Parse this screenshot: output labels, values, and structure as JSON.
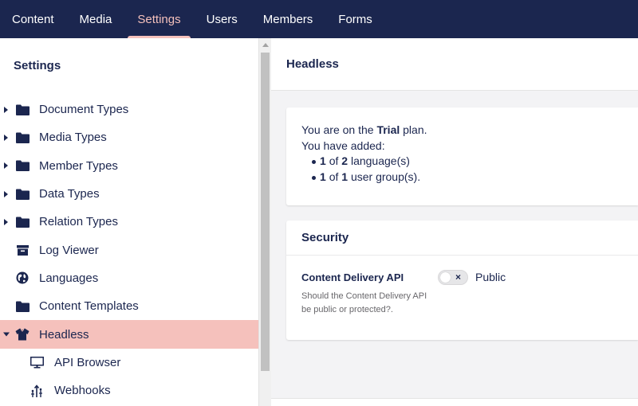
{
  "nav": {
    "items": [
      {
        "label": "Content"
      },
      {
        "label": "Media"
      },
      {
        "label": "Settings"
      },
      {
        "label": "Users"
      },
      {
        "label": "Members"
      },
      {
        "label": "Forms"
      }
    ],
    "active": "Settings"
  },
  "sidebar": {
    "title": "Settings",
    "items": [
      {
        "label": "Document Types",
        "icon": "folder-icon",
        "expandable": true
      },
      {
        "label": "Media Types",
        "icon": "folder-icon",
        "expandable": true
      },
      {
        "label": "Member Types",
        "icon": "folder-icon",
        "expandable": true
      },
      {
        "label": "Data Types",
        "icon": "folder-icon",
        "expandable": true
      },
      {
        "label": "Relation Types",
        "icon": "folder-icon",
        "expandable": true
      },
      {
        "label": "Log Viewer",
        "icon": "archive-icon",
        "expandable": false
      },
      {
        "label": "Languages",
        "icon": "globe-icon",
        "expandable": false
      },
      {
        "label": "Content Templates",
        "icon": "folder-icon",
        "expandable": false
      },
      {
        "label": "Headless",
        "icon": "headless-icon",
        "expandable": true,
        "expanded": true,
        "selected": true
      },
      {
        "label": "API Browser",
        "icon": "monitor-icon",
        "child": true
      },
      {
        "label": "Webhooks",
        "icon": "webhook-icon",
        "child": true
      }
    ]
  },
  "main": {
    "title": "Headless",
    "plan": {
      "line1_prefix": "You are on the",
      "plan_name": "Trial",
      "line1_suffix": "plan.",
      "line2": "You have added:",
      "languages": {
        "used": "1",
        "of": "of",
        "total": "2",
        "unit": "language(s)"
      },
      "user_groups": {
        "used": "1",
        "of": "of",
        "total": "1",
        "unit": "user group(s)."
      }
    },
    "security": {
      "title": "Security",
      "property_label": "Content Delivery API",
      "property_description": "Should the Content Delivery API be public or protected?.",
      "toggle_label": "Public",
      "toggle_on": false,
      "toggle_symbol": "×"
    }
  },
  "colors": {
    "navy": "#1b264f",
    "accent": "#f5c1bc",
    "muted": "#68676b"
  }
}
